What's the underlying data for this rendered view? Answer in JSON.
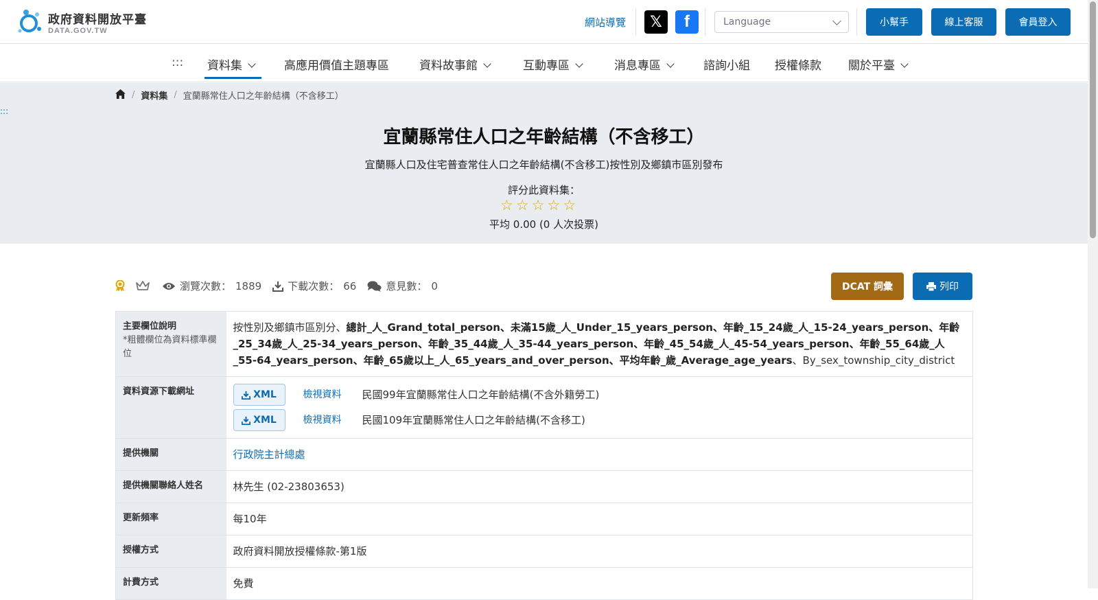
{
  "header": {
    "logo_title": "政府資料開放平臺",
    "logo_sub": "DATA.GOV.TW",
    "sitemap": "網站導覽",
    "x_icon": "x-twitter-icon",
    "fb_icon": "facebook-icon",
    "language_placeholder": "Language",
    "helper_btn": "小幫手",
    "support_btn": "線上客服",
    "login_btn": "會員登入",
    "brand_color": "#0b6cb3"
  },
  "nav": {
    "anchor": ":::",
    "items": [
      {
        "label": "資料集",
        "dropdown": true,
        "active": true
      },
      {
        "label": "高應用價值主題專區",
        "dropdown": false
      },
      {
        "label": "資料故事館",
        "dropdown": true
      },
      {
        "label": "互動專區",
        "dropdown": true
      },
      {
        "label": "消息專區",
        "dropdown": true
      },
      {
        "label": "諮詢小組",
        "dropdown": false
      },
      {
        "label": "授權條款",
        "dropdown": false
      },
      {
        "label": "關於平臺",
        "dropdown": true
      }
    ]
  },
  "breadcrumb": {
    "home_icon": "home-icon",
    "level1": "資料集",
    "current": "宜蘭縣常住人口之年齡結構（不含移工）"
  },
  "side_anchor": ":::",
  "dataset": {
    "title": "宜蘭縣常住人口之年齡結構（不含移工）",
    "subtitle": "宜蘭縣人口及住宅普查常住人口之年齡結構(不含移工)按性別及鄉鎮市區別發布",
    "rate_label": "評分此資料集：",
    "stars": "☆☆☆☆☆",
    "rating_max": 5,
    "rating_value": 0,
    "average": "平均 0.00 (0 人次投票)"
  },
  "stats": {
    "views_label": "瀏覽次數：",
    "views": "1889",
    "downloads_label": "下載次數：",
    "downloads": "66",
    "comments_label": "意見數：",
    "comments": "0",
    "dcat_btn": "DCAT 詞彙",
    "print_btn": "列印",
    "dcat_color": "#a26a14"
  },
  "table": {
    "fields_label": "主要欄位說明",
    "fields_note": "*粗體欄位為資料標準欄位",
    "fields_prefix": "按性別及鄉鎮市區別分、",
    "fields_bold": "總計_人_Grand_total_person、未滿15歲_人_Under_15_years_person、年齡_15_24歲_人_15-24_years_person、年齡_25_34歲_人_25-34_years_person、年齡_35_44歲_人_35-44_years_person、年齡_45_54歲_人_45-54_years_person、年齡_55_64歲_人_55-64_years_person、年齡_65歲以上_人_65_years_and_over_person、平均年齡_歲_Average_age_years",
    "fields_suffix": "、By_sex_township_city_district",
    "download_label": "資料資源下載網址",
    "downloads": [
      {
        "format": "XML",
        "view": "檢視資料",
        "name": "民國99年宜蘭縣常住人口之年齡結構(不含外籍勞工)"
      },
      {
        "format": "XML",
        "view": "檢視資料",
        "name": "民國109年宜蘭縣常住人口之年齡結構(不含移工)"
      }
    ],
    "provider_label": "提供機關",
    "provider": "行政院主計總處",
    "contact_label": "提供機關聯絡人姓名",
    "contact": "林先生 (02-23803653)",
    "frequency_label": "更新頻率",
    "frequency": "每10年",
    "license_label": "授權方式",
    "license": "政府資料開放授權條款-第1版",
    "fee_label": "計費方式",
    "fee": "免費"
  }
}
